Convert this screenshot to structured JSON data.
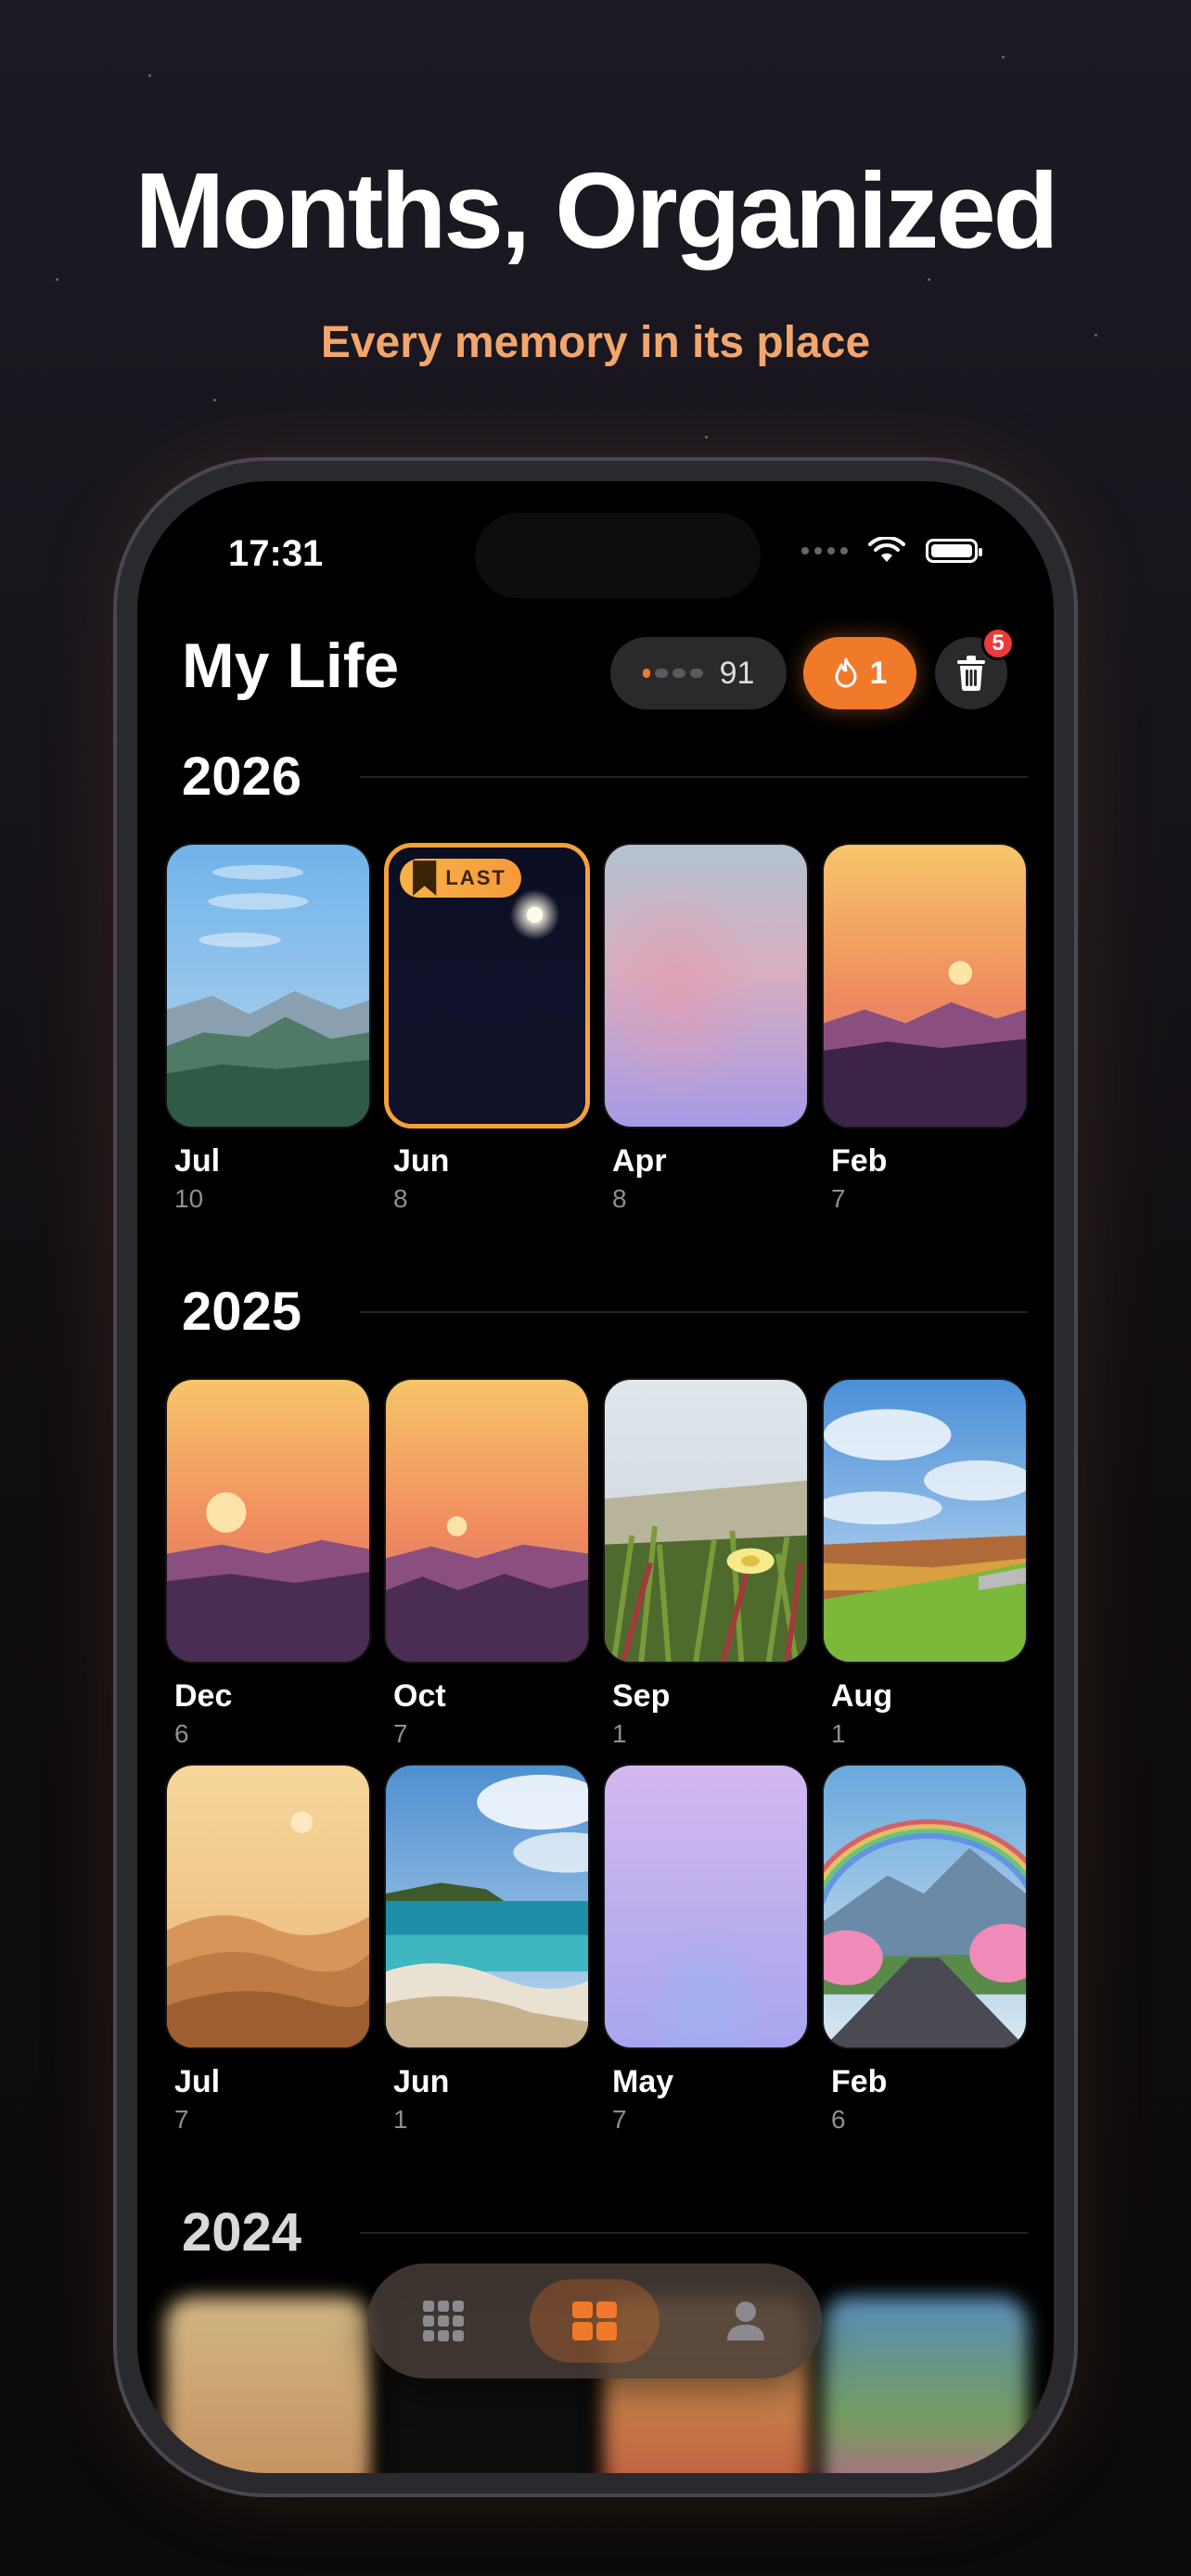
{
  "hero": {
    "headline": "Months, Organized",
    "subheadline": "Every memory in its place"
  },
  "status_bar": {
    "time": "17:31"
  },
  "header": {
    "title": "My Life",
    "progress_count": "91",
    "streak_count": "1",
    "trash_badge": "5"
  },
  "years": [
    {
      "year": "2026",
      "months": [
        {
          "label": "Jul",
          "count": "10",
          "thumb": "mountains-blue-sky"
        },
        {
          "label": "Jun",
          "count": "8",
          "thumb": "night-moon",
          "tag": "LAST"
        },
        {
          "label": "Apr",
          "count": "8",
          "thumb": "pastel-gradient"
        },
        {
          "label": "Feb",
          "count": "7",
          "thumb": "sunset-mountains"
        }
      ]
    },
    {
      "year": "2025",
      "months": [
        {
          "label": "Dec",
          "count": "6",
          "thumb": "sunset-mountains"
        },
        {
          "label": "Oct",
          "count": "7",
          "thumb": "sunset-mountains"
        },
        {
          "label": "Sep",
          "count": "1",
          "thumb": "flower-photo"
        },
        {
          "label": "Aug",
          "count": "1",
          "thumb": "meadow-photo"
        },
        {
          "label": "Jul",
          "count": "7",
          "thumb": "desert-dunes"
        },
        {
          "label": "Jun",
          "count": "1",
          "thumb": "beach-photo"
        },
        {
          "label": "May",
          "count": "7",
          "thumb": "lavender-gradient"
        },
        {
          "label": "Feb",
          "count": "6",
          "thumb": "rainbow-road-photo"
        }
      ]
    },
    {
      "year": "2024",
      "months": []
    }
  ],
  "tab_bar": {
    "tabs": [
      {
        "icon": "grid-icon",
        "active": false
      },
      {
        "icon": "months-icon",
        "active": true
      },
      {
        "icon": "profile-icon",
        "active": false
      }
    ]
  },
  "colors": {
    "accent": "#f07a2a",
    "subheadline": "#f2a66b",
    "badge": "#ee3a3a"
  }
}
